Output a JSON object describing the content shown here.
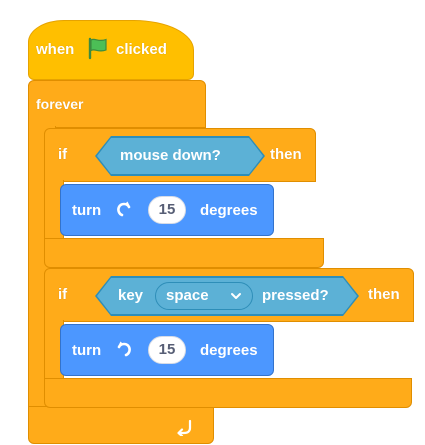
{
  "script": {
    "hat": {
      "label_when": "when",
      "flag_icon": "green-flag-icon",
      "label_clicked": "clicked"
    },
    "forever": {
      "label": "forever",
      "loop_arrow_icon": "loop-arrow-icon"
    },
    "if1": {
      "label_if": "if",
      "condition": "mouse down?",
      "label_then": "then",
      "turn": {
        "label_turn": "turn",
        "direction_icon": "rotate-right-icon",
        "value": "15",
        "label_degrees": "degrees"
      }
    },
    "if2": {
      "label_if": "if",
      "condition": {
        "label_key": "key",
        "key_value": "space",
        "dropdown_icon": "chevron-down-icon",
        "label_pressed": "pressed?"
      },
      "label_then": "then",
      "turn": {
        "label_turn": "turn",
        "direction_icon": "rotate-left-icon",
        "value": "15",
        "label_degrees": "degrees"
      }
    }
  },
  "colors": {
    "events": "#ffbf00",
    "control": "#ffab19",
    "sensing": "#5cb1d6",
    "motion": "#4c97ff",
    "flag": "#4cbf56"
  }
}
